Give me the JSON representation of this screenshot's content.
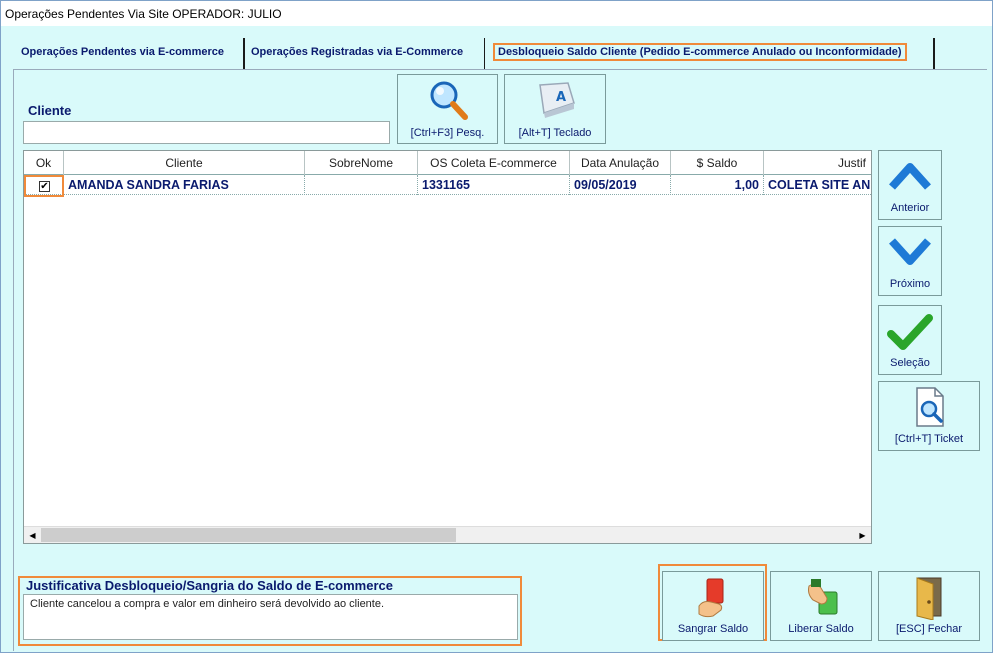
{
  "window": {
    "title": "Operações Pendentes Via Site OPERADOR: JULIO"
  },
  "tabs": [
    {
      "label": "Operações Pendentes via E-commerce"
    },
    {
      "label": "Operações Registradas via E-Commerce"
    },
    {
      "label": "Desbloqueio Saldo Cliente (Pedido E-commerce Anulado ou Inconformidade)"
    }
  ],
  "search": {
    "label": "Cliente",
    "value": ""
  },
  "toolbar": {
    "search_label": "[Ctrl+F3] Pesq.",
    "keyboard_label": "[Alt+T] Teclado",
    "keyboard_key": "A"
  },
  "grid": {
    "columns": [
      "Ok",
      "Cliente",
      "SobreNome",
      "OS Coleta E-commerce",
      "Data Anulação",
      "$ Saldo",
      "Justif"
    ],
    "rows": [
      {
        "ok": true,
        "ok_mark": "✔",
        "cliente": "AMANDA SANDRA FARIAS",
        "sobrenome": "",
        "os": "1331165",
        "data": "09/05/2019",
        "saldo": "1,00",
        "justif": "COLETA SITE AN"
      }
    ]
  },
  "side_buttons": {
    "previous": "Anterior",
    "next": "Próximo",
    "selection": "Seleção",
    "ticket": "[Ctrl+T] Ticket"
  },
  "justification": {
    "label": "Justificativa Desbloqueio/Sangria do Saldo de E-commerce",
    "text": "Cliente cancelou a compra e valor em dinheiro será devolvido ao cliente."
  },
  "bottom_buttons": {
    "bleed": "Sangrar Saldo",
    "release": "Liberar Saldo",
    "close": "[ESC] Fechar"
  },
  "colors": {
    "accent": "#f08a3a",
    "background": "#d9fafa",
    "text": "#0a1a6e",
    "arrow_blue": "#1e7ad6",
    "check_green": "#2aa52a"
  }
}
